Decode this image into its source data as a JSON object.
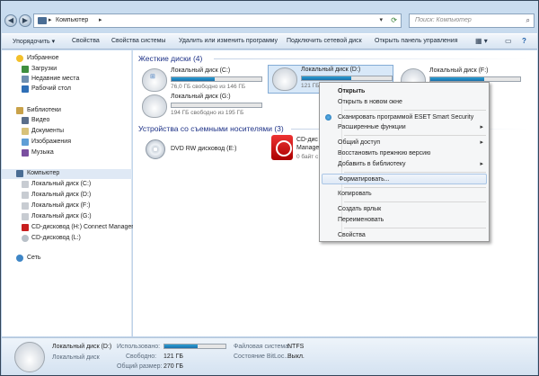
{
  "address": {
    "path": "Компьютер",
    "search_placeholder": "Поиск: Компьютер"
  },
  "toolbar": {
    "items": [
      "Упорядочить ▾",
      "Свойства",
      "Свойства системы",
      "Удалить или изменить программу",
      "Подключить сетевой диск",
      "Открыть панель управления"
    ]
  },
  "nav": {
    "favorites": "Избранное",
    "downloads": "Загрузки",
    "recent": "Недавние места",
    "desktop": "Рабочий стол",
    "libraries": "Библиотеки",
    "video": "Видео",
    "documents": "Документы",
    "images": "Изображения",
    "music": "Музыка",
    "computer": "Компьютер",
    "disk_c": "Локальный диск (C:)",
    "disk_d": "Локальный диск (D:)",
    "disk_f": "Локальный диск (F:)",
    "disk_g": "Локальный диск (G:)",
    "cd_h": "CD-дисковод (H:) Connect Manager",
    "cd_l": "CD-дисковод (L:)",
    "network": "Сеть"
  },
  "content": {
    "hdd_header": "Жесткие диски (4)",
    "removable_header": "Устройства со съемными носителями (3)",
    "drives": [
      {
        "name": "Локальный диск (C:)",
        "free": "76,0 ГБ свободно из 146 ГБ",
        "used_fraction": 0.48
      },
      {
        "name": "Локальный диск (D:)",
        "free": "121 ГБ свободно из 270 ГБ",
        "used_fraction": 0.55
      },
      {
        "name": "Локальный диск (F:)",
        "free": "",
        "used_fraction": 0.6
      },
      {
        "name": "Локальный диск (G:)",
        "free": "194 ГБ свободно из 195 ГБ",
        "used_fraction": 0.0
      }
    ],
    "dvd": "DVD RW дисковод (E:)",
    "cd_h_line1": "CD-дис",
    "cd_h_line2": "Manage",
    "cd_h_line3": "0 байт с"
  },
  "menu": {
    "open": "Открыть",
    "open_new": "Открыть в новом окне",
    "eset": "Сканировать программой ESET Smart Security",
    "advanced": "Расширенные функции",
    "share": "Общий доступ",
    "restore": "Восстановить прежнюю версию",
    "library": "Добавить в библиотеку",
    "format": "Форматировать...",
    "copy": "Копировать",
    "shortcut": "Создать ярлык",
    "rename": "Переименовать",
    "properties": "Свойства"
  },
  "details": {
    "name": "Локальный диск (D:)",
    "type": "Локальный диск",
    "used_label": "Использовано:",
    "free_label": "Свободно:",
    "free_value": "121 ГБ",
    "total_label": "Общий размер:",
    "total_value": "270 ГБ",
    "fs_label": "Файловая система:",
    "fs_value": "NTFS",
    "bitlocker_label": "Состояние BitLoc...",
    "bitlocker_value": "Выкл.",
    "used_fraction": 0.55
  }
}
